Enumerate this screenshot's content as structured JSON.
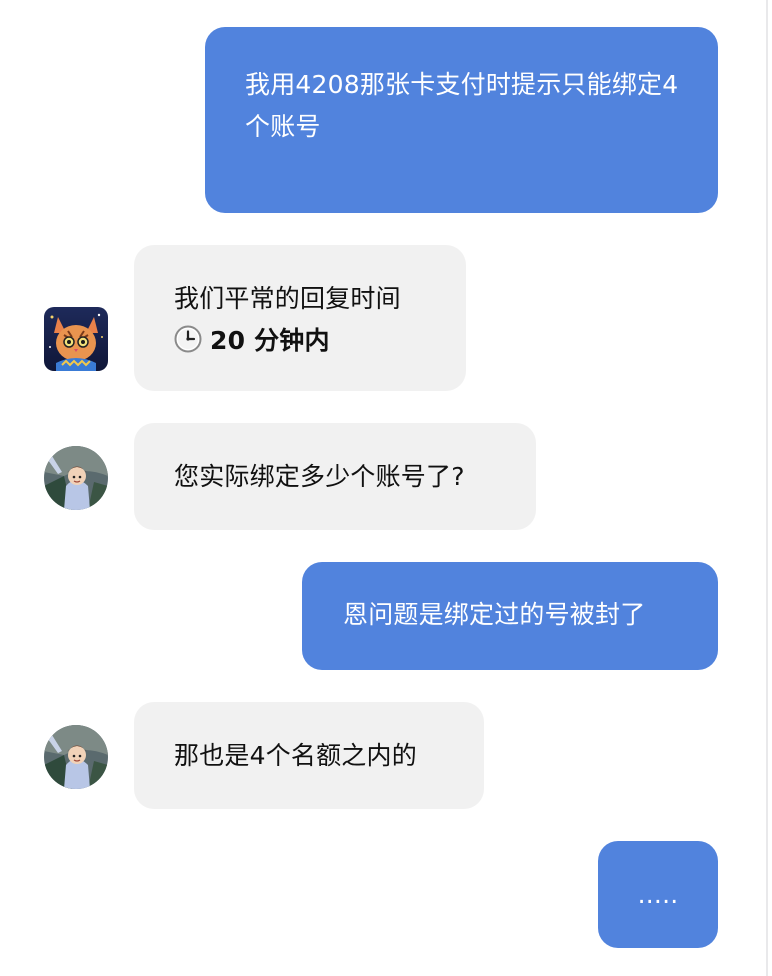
{
  "conversation": {
    "messages": [
      {
        "role": "user",
        "text": "我用4208那张卡支付时提示只能绑定4个账号"
      },
      {
        "role": "agent",
        "avatar": "cat-avatar-icon",
        "line1": "我们平常的回复时间",
        "line2_icon": "clock-icon",
        "line2_bold": "20 分钟内"
      },
      {
        "role": "agent",
        "avatar": "person-avatar-icon",
        "text": "您实际绑定多少个账号了?"
      },
      {
        "role": "user",
        "text": "恩问题是绑定过的号被封了"
      },
      {
        "role": "agent",
        "avatar": "person-avatar-icon",
        "text": "那也是4个名额之内的"
      },
      {
        "role": "user",
        "text": "....."
      }
    ]
  },
  "colors": {
    "user_bubble": "#5183dd",
    "agent_bubble": "#f1f1f1",
    "background": "#ffffff"
  }
}
